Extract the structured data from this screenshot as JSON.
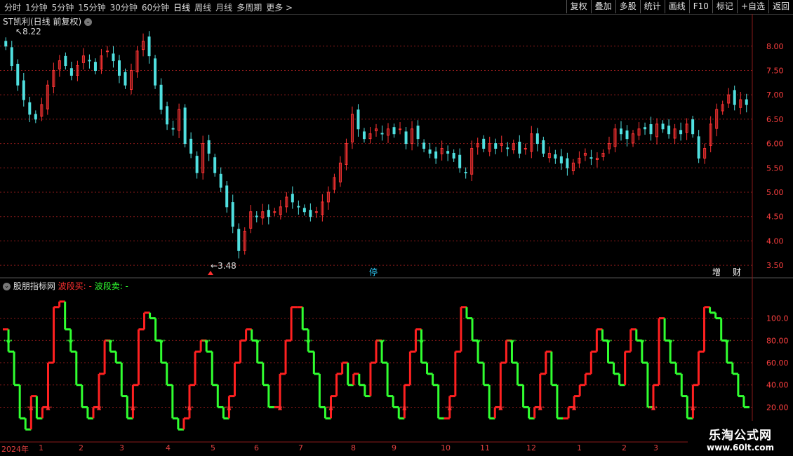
{
  "toolbar": {
    "periods": [
      "分时",
      "1分钟",
      "5分钟",
      "15分钟",
      "30分钟",
      "60分钟",
      "日线",
      "周线",
      "月线",
      "多周期",
      "更多 >"
    ],
    "active_period": "日线",
    "actions": [
      "复权",
      "叠加",
      "多股",
      "统计",
      "画线",
      "F10",
      "标记",
      "+自选",
      "返回"
    ]
  },
  "main_panel": {
    "title": "ST凯利(日线 前复权)",
    "price_high_label": "8.22",
    "price_low_label": "3.48",
    "markers": [
      "停",
      "增",
      "财"
    ],
    "colors": {
      "up": "#ff3333",
      "down": "#50e0e0",
      "grid": "#8a1a1a",
      "axis_text": "#ff4040"
    }
  },
  "indicator_panel": {
    "title": "股朋指标网",
    "legend_buy": "波段买: -",
    "legend_sell": "波段卖: -",
    "colors": {
      "up": "#ff2020",
      "down": "#30ff30",
      "buy_arrow": "#ff3030",
      "sell_arrow": "#30ff30"
    }
  },
  "x_axis": {
    "labels": [
      "2024年",
      "1",
      "2",
      "3",
      "4",
      "5",
      "6",
      "7",
      "8",
      "9",
      "10",
      "11",
      "12",
      "1",
      "2",
      "3"
    ]
  },
  "watermark": {
    "name": "乐淘公式网",
    "url": "www.60lt.com"
  },
  "chart_data": [
    {
      "type": "candlestick",
      "title": "ST凯利(日线 前复权)",
      "ylim": [
        3.3,
        8.4
      ],
      "y_ticks": [
        "8.00",
        "7.50",
        "7.00",
        "6.50",
        "6.00",
        "5.50",
        "5.00",
        "4.50",
        "4.00",
        "3.50"
      ],
      "close": [
        8.0,
        7.6,
        7.2,
        6.9,
        6.6,
        6.5,
        6.8,
        7.2,
        7.5,
        7.7,
        7.6,
        7.4,
        7.6,
        7.8,
        7.7,
        7.5,
        7.8,
        7.9,
        7.7,
        7.4,
        7.2,
        7.5,
        7.9,
        8.1,
        7.8,
        7.2,
        6.7,
        6.4,
        6.3,
        6.7,
        6.0,
        5.8,
        5.4,
        6.0,
        5.8,
        5.4,
        5.1,
        4.7,
        4.3,
        3.8,
        4.2,
        4.6,
        4.5,
        4.6,
        4.5,
        4.6,
        4.7,
        4.9,
        4.8,
        4.7,
        4.6,
        4.5,
        4.6,
        4.8,
        5.0,
        5.3,
        5.6,
        6.0,
        6.6,
        6.3,
        6.1,
        6.2,
        6.3,
        6.2,
        6.3,
        6.2,
        6.3,
        6.0,
        6.3,
        6.1,
        5.9,
        5.8,
        5.7,
        5.9,
        5.8,
        5.7,
        5.5,
        5.4,
        5.9,
        6.0,
        5.9,
        6.0,
        5.9,
        6.0,
        5.9,
        6.0,
        5.8,
        5.9,
        6.2,
        6.0,
        5.8,
        5.8,
        5.7,
        5.6,
        5.5,
        5.6,
        5.7,
        5.8,
        5.7,
        5.7,
        5.8,
        6.0,
        6.3,
        6.2,
        6.1,
        6.2,
        6.3,
        6.3,
        6.2,
        6.4,
        6.3,
        6.2,
        6.3,
        6.2,
        6.4,
        6.2,
        5.7,
        5.9,
        6.4,
        6.7,
        6.8,
        7.0,
        6.8,
        6.9,
        6.8
      ],
      "ticks_count": 124
    },
    {
      "type": "step-oscillator",
      "title": "股朋指标网",
      "ylim": [
        -10,
        125
      ],
      "y_ticks": [
        "100.0",
        "80.00",
        "60.00",
        "40.00",
        "20.00"
      ],
      "series": [
        {
          "name": "波段买",
          "values": [
            90,
            70,
            40,
            10,
            0,
            30,
            10,
            20,
            60,
            110,
            115,
            90,
            70,
            40,
            20,
            10,
            20,
            50,
            80,
            70,
            60,
            30,
            10,
            40,
            90,
            105,
            100,
            80,
            60,
            40,
            10,
            0,
            10,
            40,
            70,
            80,
            70,
            40,
            20,
            10,
            30,
            60,
            80,
            90,
            80,
            60,
            40,
            20,
            20,
            50,
            80,
            110,
            110,
            90,
            70,
            50,
            20,
            10,
            30,
            50,
            60,
            40,
            50,
            40,
            30,
            60,
            80,
            60,
            30,
            20,
            10,
            40,
            70,
            90,
            60,
            50,
            40,
            10,
            10,
            30,
            70,
            110,
            100,
            80,
            60,
            40,
            10,
            20,
            60,
            80,
            60,
            40,
            20,
            10,
            20,
            50,
            70,
            40,
            10,
            10,
            20,
            30,
            40,
            50,
            70,
            90,
            80,
            60,
            50,
            40,
            70,
            90,
            80,
            60,
            20,
            40,
            100,
            80,
            60,
            50,
            30,
            10,
            40,
            70,
            110,
            105,
            100,
            80,
            60,
            50,
            30,
            20
          ]
        }
      ],
      "buy_level": 20,
      "sell_level": 80
    }
  ]
}
